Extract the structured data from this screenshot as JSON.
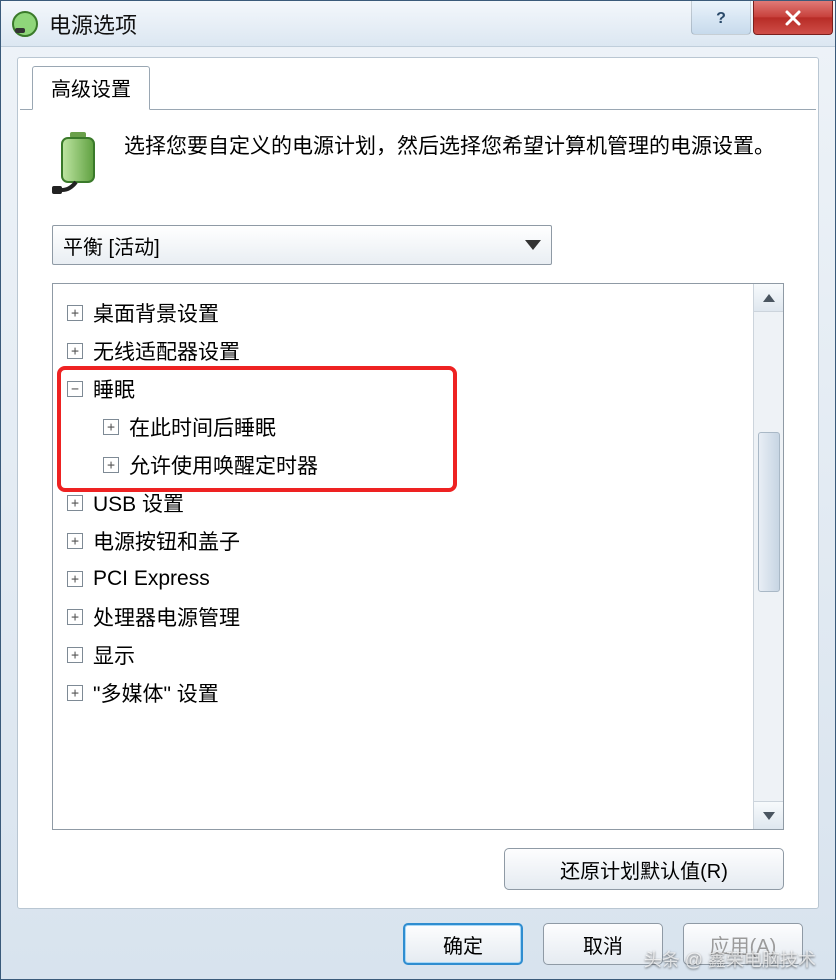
{
  "titlebar": {
    "title": "电源选项"
  },
  "tab": {
    "label": "高级设置"
  },
  "intro": {
    "text": "选择您要自定义的电源计划，然后选择您希望计算机管理的电源设置。"
  },
  "plan_select": {
    "current": "平衡 [活动]"
  },
  "tree": {
    "items": [
      {
        "label": "桌面背景设置",
        "collapsed": true
      },
      {
        "label": "无线适配器设置",
        "collapsed": true
      },
      {
        "label": "睡眠",
        "collapsed": false,
        "children": [
          {
            "label": "在此时间后睡眠",
            "collapsed": true
          },
          {
            "label": "允许使用唤醒定时器",
            "collapsed": true
          }
        ]
      },
      {
        "label": "USB 设置",
        "collapsed": true
      },
      {
        "label": "电源按钮和盖子",
        "collapsed": true
      },
      {
        "label": "PCI Express",
        "collapsed": true
      },
      {
        "label": "处理器电源管理",
        "collapsed": true
      },
      {
        "label": "显示",
        "collapsed": true
      },
      {
        "label": "\"多媒体\" 设置",
        "collapsed": true
      }
    ]
  },
  "buttons": {
    "restore": "还原计划默认值(R)",
    "ok": "确定",
    "cancel": "取消",
    "apply": "应用(A)"
  },
  "watermark": "头条 @ 鑫荣电脑技术"
}
